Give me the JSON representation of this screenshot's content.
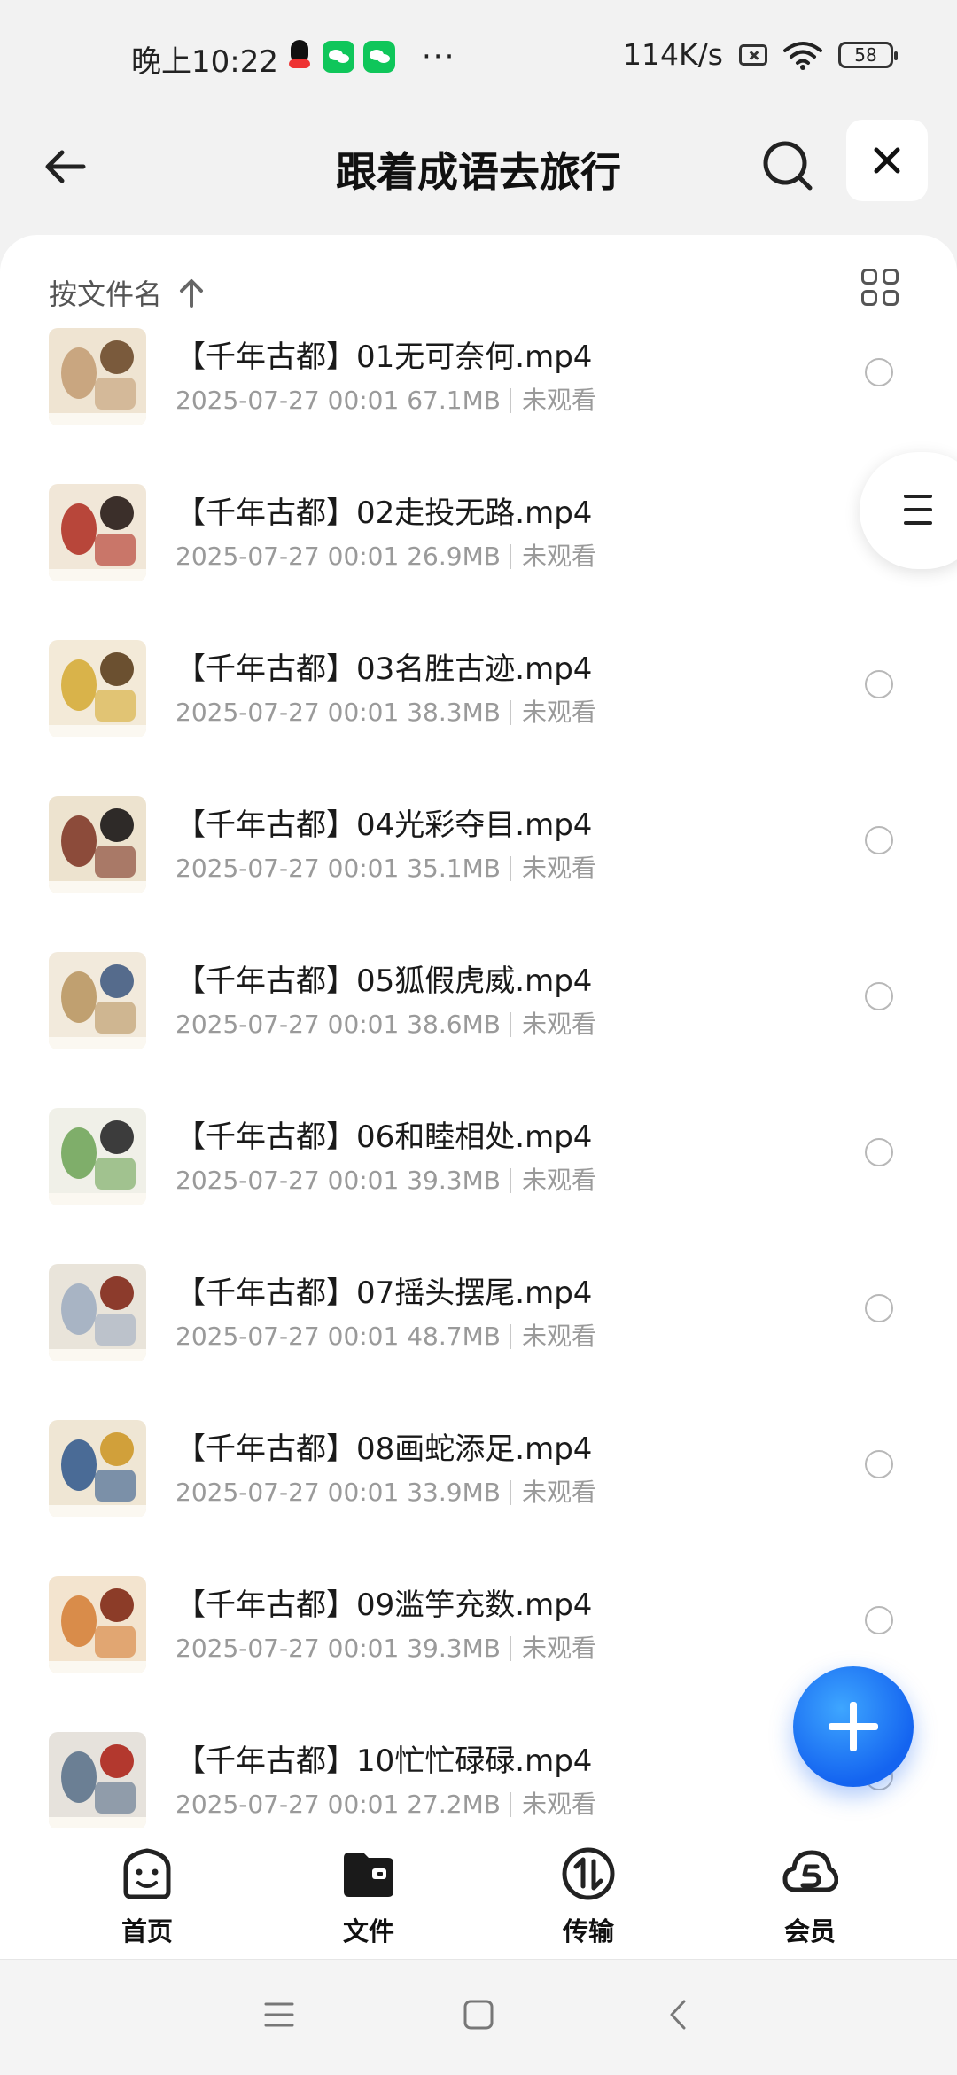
{
  "status_bar": {
    "time": "晚上10:22",
    "more": "···",
    "speed": "114K/s",
    "battery": "58"
  },
  "header": {
    "title": "跟着成语去旅行"
  },
  "sort": {
    "label": "按文件名"
  },
  "files": [
    {
      "name": "【千年古都】01无可奈何.mp4",
      "date": "2025-07-27 00:01",
      "size": "67.1MB",
      "status": "未观看"
    },
    {
      "name": "【千年古都】02走投无路.mp4",
      "date": "2025-07-27 00:01",
      "size": "26.9MB",
      "status": "未观看"
    },
    {
      "name": "【千年古都】03名胜古迹.mp4",
      "date": "2025-07-27 00:01",
      "size": "38.3MB",
      "status": "未观看"
    },
    {
      "name": "【千年古都】04光彩夺目.mp4",
      "date": "2025-07-27 00:01",
      "size": "35.1MB",
      "status": "未观看"
    },
    {
      "name": "【千年古都】05狐假虎威.mp4",
      "date": "2025-07-27 00:01",
      "size": "38.6MB",
      "status": "未观看"
    },
    {
      "name": "【千年古都】06和睦相处.mp4",
      "date": "2025-07-27 00:01",
      "size": "39.3MB",
      "status": "未观看"
    },
    {
      "name": "【千年古都】07摇头摆尾.mp4",
      "date": "2025-07-27 00:01",
      "size": "48.7MB",
      "status": "未观看"
    },
    {
      "name": "【千年古都】08画蛇添足.mp4",
      "date": "2025-07-27 00:01",
      "size": "33.9MB",
      "status": "未观看"
    },
    {
      "name": "【千年古都】09滥竽充数.mp4",
      "date": "2025-07-27 00:01",
      "size": "39.3MB",
      "status": "未观看"
    },
    {
      "name": "【千年古都】10忙忙碌碌.mp4",
      "date": "2025-07-27 00:01",
      "size": "27.2MB",
      "status": "未观看"
    }
  ],
  "bottom_nav": [
    {
      "label": "首页",
      "icon": "smiley-home-icon"
    },
    {
      "label": "文件",
      "icon": "folder-icon"
    },
    {
      "label": "传输",
      "icon": "transfer-icon"
    },
    {
      "label": "会员",
      "icon": "cloud-vip-icon"
    }
  ],
  "colors": {
    "accent": "#1464f0",
    "background": "#f2f2f2",
    "sheet": "#ffffff",
    "meta_text": "#9a9a9a"
  }
}
